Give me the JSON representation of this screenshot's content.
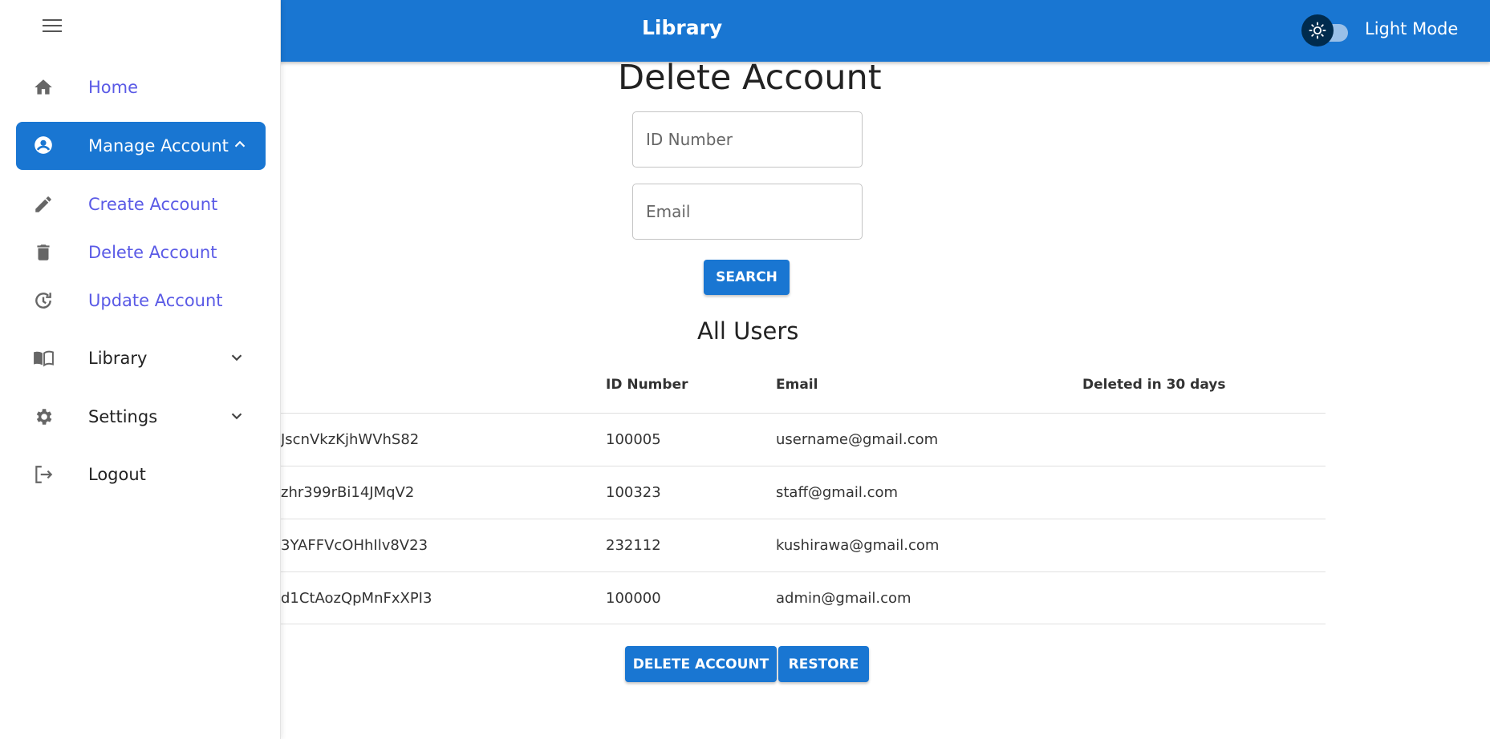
{
  "appbar": {
    "title": "Library",
    "mode_label": "Light Mode"
  },
  "sidebar": {
    "items": [
      {
        "label": "Home",
        "icon": "home-icon"
      },
      {
        "label": "Manage Account",
        "icon": "account-circle-icon"
      },
      {
        "label": "Create Account",
        "icon": "pencil-icon"
      },
      {
        "label": "Delete Account",
        "icon": "trash-icon"
      },
      {
        "label": "Update Account",
        "icon": "history-icon"
      },
      {
        "label": "Library",
        "icon": "book-open-icon"
      },
      {
        "label": "Settings",
        "icon": "gear-icon"
      },
      {
        "label": "Logout",
        "icon": "logout-icon"
      }
    ]
  },
  "main": {
    "title": "Delete Account",
    "id_placeholder": "ID Number",
    "email_placeholder": "Email",
    "search_label": "SEARCH",
    "users_title": "All Users",
    "columns": [
      "ID Number",
      "Email",
      "Deleted in 30 days"
    ],
    "rows": [
      {
        "uid": "JscnVkzKjhWVhS82",
        "id_number": "100005",
        "email": "username@gmail.com",
        "deleted": ""
      },
      {
        "uid": "zhr399rBi14JMqV2",
        "id_number": "100323",
        "email": "staff@gmail.com",
        "deleted": ""
      },
      {
        "uid": "3YAFFVcOHhIlv8V23",
        "id_number": "232112",
        "email": "kushirawa@gmail.com",
        "deleted": ""
      },
      {
        "uid": "d1CtAozQpMnFxXPI3",
        "id_number": "100000",
        "email": "admin@gmail.com",
        "deleted": ""
      }
    ],
    "delete_label": "DELETE ACCOUNT",
    "restore_label": "RESTORE"
  },
  "colors": {
    "primary": "#1976d2",
    "link": "#5a5ae6",
    "toggle_thumb": "#002b4d"
  }
}
